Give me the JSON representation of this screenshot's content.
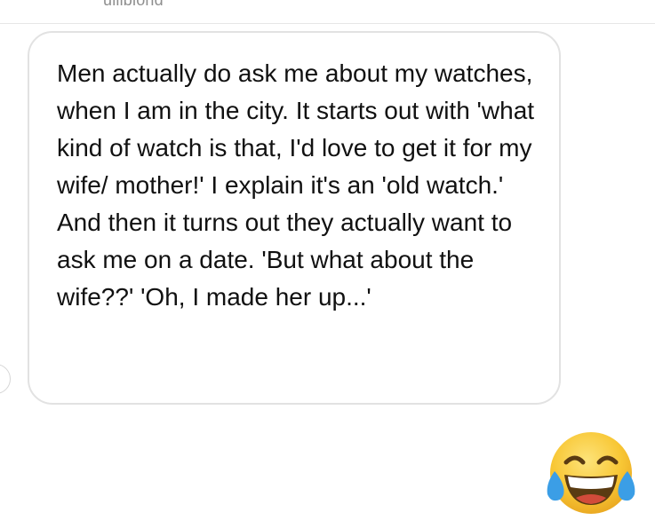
{
  "header": {
    "cropped_name": "ulliblond"
  },
  "message": {
    "text": "Men actually do ask me about my watches, when I am in the city. It starts out with 'what kind of watch is that, I'd love to get it for my wife/ mother!' I explain it's an 'old watch.' And then it turns out they actually want to ask me on a date. 'But what about the wife??' 'Oh, I made her up...'"
  },
  "reaction": {
    "emoji_icon": "face-with-tears-of-joy-icon"
  },
  "colors": {
    "bubble_border": "#e2e2e2",
    "text": "#111111",
    "emoji_yellow": "#f8c735",
    "emoji_tears": "#3b9ee6"
  }
}
